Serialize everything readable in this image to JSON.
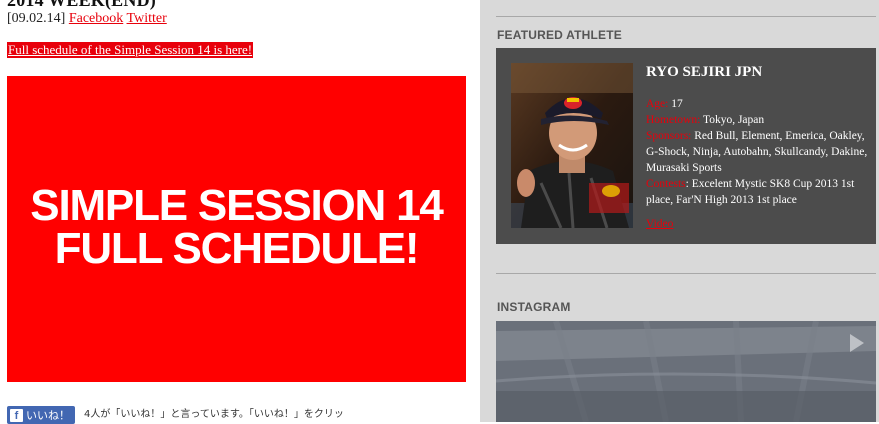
{
  "post": {
    "title": "2014 WEEK(END)",
    "date": "[09.02.14]",
    "share_facebook": "Facebook",
    "share_twitter": "Twitter",
    "schedule_link": "Full schedule of the Simple Session 14 is here!",
    "banner": {
      "line1": "SIMPLE SESSION 14",
      "line2": "FULL SCHEDULE!"
    },
    "like_button": "いいね！",
    "like_text": "4人が「いいね！」と言っています。「いいね！」をクリッ"
  },
  "sidebar": {
    "featured_heading": "FEATURED ATHLETE",
    "athlete": {
      "name": "RYO SEJIRI JPN",
      "age_label": "Age:",
      "age": " 17",
      "hometown_label": "Hometown:",
      "hometown": " Tokyo, Japan",
      "sponsors_label": "Sponsors:",
      "sponsors": " Red Bull, Element, Emerica, Oakley, G-Shock, Ninja, Autobahn, Skullcandy, Dakine, Murasaki Sports",
      "contests_label": "Contests",
      "contests": ": Excelent Mystic SK8 Cup 2013 1st place, Far'N High 2013 1st place",
      "video": "Video"
    },
    "instagram_heading": "INSTAGRAM"
  },
  "colors": {
    "accent": "#e8000b",
    "banner": "#ff0000",
    "panel": "#4c4c4c",
    "sidebar_bg": "#d9d9d9"
  }
}
